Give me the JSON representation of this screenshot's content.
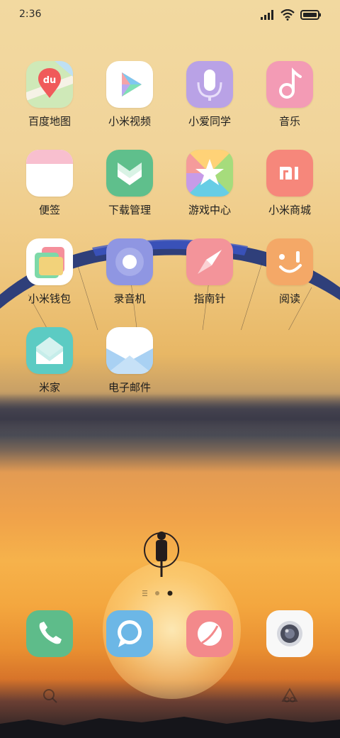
{
  "status_bar": {
    "time": "2:36"
  },
  "apps": [
    {
      "label": "百度地图",
      "icon": "baidu-map-icon"
    },
    {
      "label": "小米视频",
      "icon": "mi-video-icon"
    },
    {
      "label": "小爱同学",
      "icon": "xiaoai-icon"
    },
    {
      "label": "音乐",
      "icon": "music-icon"
    },
    {
      "label": "便签",
      "icon": "notes-icon"
    },
    {
      "label": "下载管理",
      "icon": "download-icon"
    },
    {
      "label": "游戏中心",
      "icon": "game-center-icon"
    },
    {
      "label": "小米商城",
      "icon": "mi-store-icon"
    },
    {
      "label": "小米钱包",
      "icon": "wallet-icon"
    },
    {
      "label": "录音机",
      "icon": "recorder-icon"
    },
    {
      "label": "指南针",
      "icon": "compass-icon"
    },
    {
      "label": "阅读",
      "icon": "reader-icon"
    },
    {
      "label": "米家",
      "icon": "mijia-icon"
    },
    {
      "label": "电子邮件",
      "icon": "email-icon"
    }
  ],
  "app_icon_texts": {
    "baidu_map": "du"
  },
  "dock": [
    {
      "icon": "phone-icon"
    },
    {
      "icon": "messages-icon"
    },
    {
      "icon": "browser-icon"
    },
    {
      "icon": "camera-icon"
    }
  ],
  "page_indicator": {
    "pages": 2,
    "current": 2
  },
  "colors": {
    "label_text": "#1e1e1e",
    "status_text": "#2b2b2b"
  }
}
